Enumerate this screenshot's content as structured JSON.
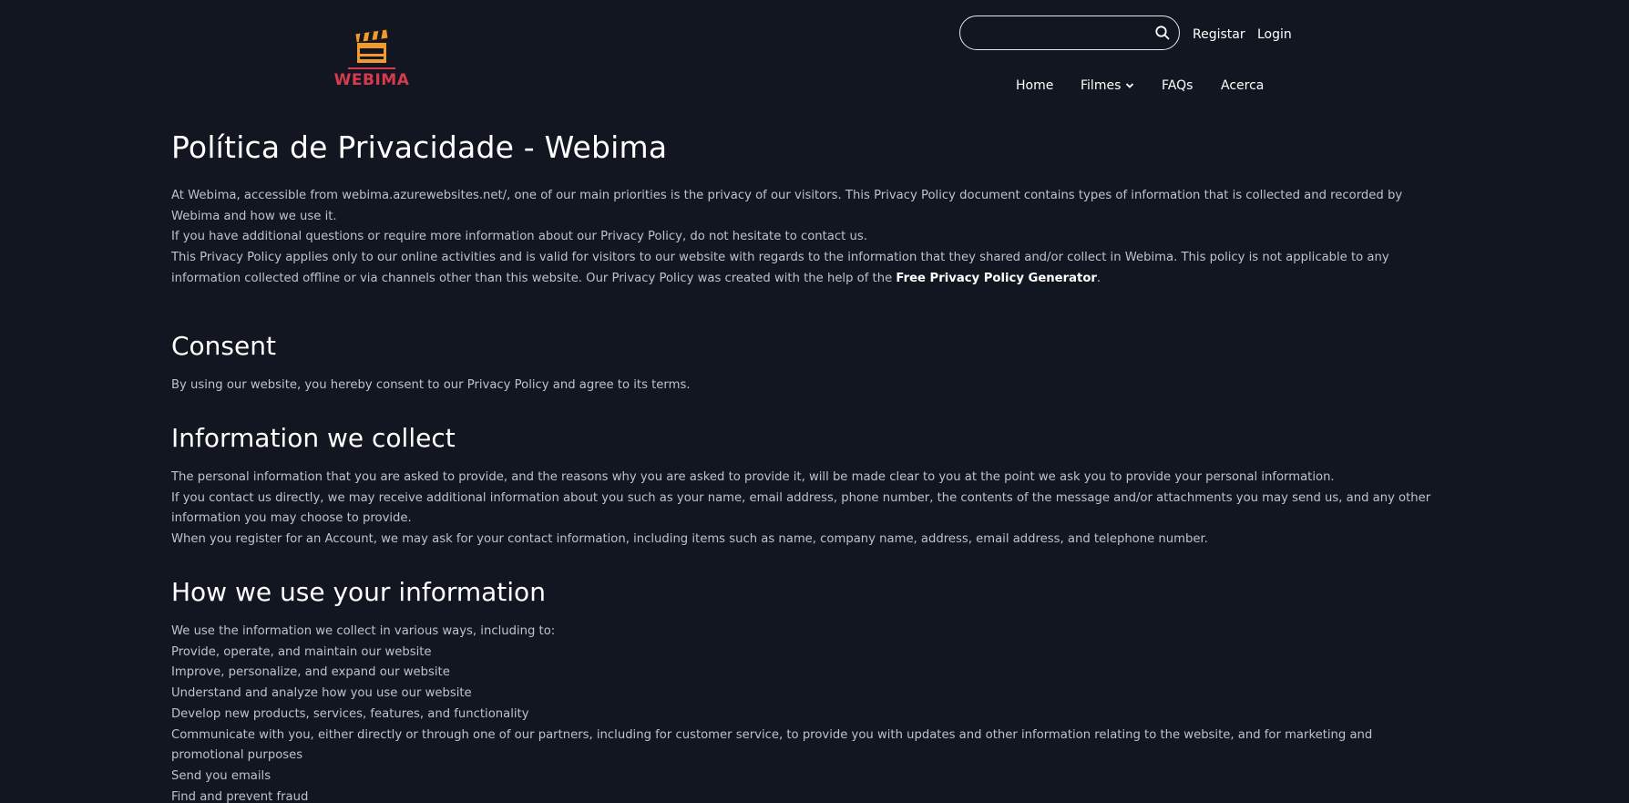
{
  "header": {
    "logo_text": "WEBIMA",
    "search": {
      "placeholder": "",
      "value": ""
    },
    "register_label": "Registar",
    "login_label": "Login"
  },
  "nav": {
    "items": [
      {
        "label": "Home"
      },
      {
        "label": "Filmes",
        "has_dropdown": true
      },
      {
        "label": "FAQs"
      },
      {
        "label": "Acerca"
      }
    ]
  },
  "content": {
    "title": "Política de Privacidade - Webima",
    "intro": {
      "p1": "At Webima, accessible from webima.azurewebsites.net/, one of our main priorities is the privacy of our visitors. This Privacy Policy document contains types of information that is collected and recorded by Webima and how we use it.",
      "p2": "If you have additional questions or require more information about our Privacy Policy, do not hesitate to contact us.",
      "p3_before": "This Privacy Policy applies only to our online activities and is valid for visitors to our website with regards to the information that they shared and/or collect in Webima. This policy is not applicable to any information collected offline or via channels other than this website. Our Privacy Policy was created with the help of the ",
      "p3_link": "Free Privacy Policy Generator",
      "p3_after": "."
    },
    "consent": {
      "heading": "Consent",
      "text": "By using our website, you hereby consent to our Privacy Policy and agree to its terms."
    },
    "information": {
      "heading": "Information we collect",
      "p1": "The personal information that you are asked to provide, and the reasons why you are asked to provide it, will be made clear to you at the point we ask you to provide your personal information.",
      "p2": "If you contact us directly, we may receive additional information about you such as your name, email address, phone number, the contents of the message and/or attachments you may send us, and any other information you may choose to provide.",
      "p3": "When you register for an Account, we may ask for your contact information, including items such as name, company name, address, email address, and telephone number."
    },
    "usage": {
      "heading": "How we use your information",
      "intro": "We use the information we collect in various ways, including to:",
      "items": [
        "Provide, operate, and maintain our website",
        "Improve, personalize, and expand our website",
        "Understand and analyze how you use our website",
        "Develop new products, services, features, and functionality",
        "Communicate with you, either directly or through one of our partners, including for customer service, to provide you with updates and other information relating to the website, and for marketing and promotional purposes",
        "Send you emails",
        "Find and prevent fraud"
      ]
    }
  },
  "colors": {
    "background": "#121620",
    "text": "#bfc2c8",
    "heading": "#ffffff",
    "logo_orange": "#f39a2c",
    "logo_red": "#d73a4e"
  }
}
